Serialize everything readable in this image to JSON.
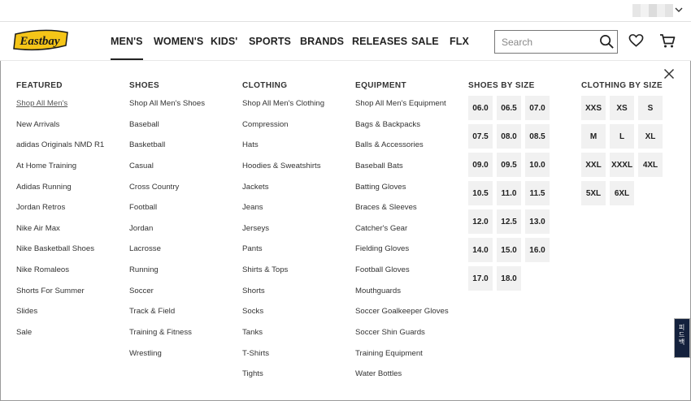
{
  "brand": {
    "logo_text": "Eastbay",
    "accent": "#f5c518"
  },
  "nav": {
    "items": [
      {
        "label": "MEN'S",
        "active": true
      },
      {
        "label": "WOMEN'S"
      },
      {
        "label": "KIDS'"
      },
      {
        "label": "SPORTS"
      },
      {
        "label": "BRANDS"
      },
      {
        "label": "RELEASES"
      },
      {
        "label": "SALE"
      },
      {
        "label": "FLX"
      }
    ]
  },
  "search": {
    "placeholder": "Search"
  },
  "icons": {
    "search": "search-icon",
    "wishlist": "heart-icon",
    "cart": "cart-icon",
    "close": "close-icon",
    "account": "chevron-down-icon"
  },
  "menu": {
    "featured": {
      "title": "FEATURED",
      "items": [
        "Shop All Men's",
        "New Arrivals",
        "adidas Originals NMD R1",
        "At Home Training",
        "Adidas Running",
        "Jordan Retros",
        "Nike Air Max",
        "Nike Basketball Shoes",
        "Nike Romaleos",
        "Shorts For Summer",
        "Slides",
        "Sale"
      ]
    },
    "shoes": {
      "title": "SHOES",
      "items": [
        "Shop All Men's Shoes",
        "Baseball",
        "Basketball",
        "Casual",
        "Cross Country",
        "Football",
        "Jordan",
        "Lacrosse",
        "Running",
        "Soccer",
        "Track & Field",
        "Training & Fitness",
        "Wrestling"
      ]
    },
    "clothing": {
      "title": "CLOTHING",
      "items": [
        "Shop All Men's Clothing",
        "Compression",
        "Hats",
        "Hoodies & Sweatshirts",
        "Jackets",
        "Jeans",
        "Jerseys",
        "Pants",
        "Shirts & Tops",
        "Shorts",
        "Socks",
        "Tanks",
        "T-Shirts",
        "Tights"
      ]
    },
    "equipment": {
      "title": "EQUIPMENT",
      "items": [
        "Shop All Men's Equipment",
        "Bags & Backpacks",
        "Balls & Accessories",
        "Baseball Bats",
        "Batting Gloves",
        "Braces & Sleeves",
        "Catcher's Gear",
        "Fielding Gloves",
        "Football Gloves",
        "Mouthguards",
        "Soccer Goalkeeper Gloves",
        "Soccer Shin Guards",
        "Training Equipment",
        "Water Bottles"
      ]
    },
    "shoe_sizes": {
      "title": "SHOES BY SIZE",
      "sizes": [
        "06.0",
        "06.5",
        "07.0",
        "07.5",
        "08.0",
        "08.5",
        "09.0",
        "09.5",
        "10.0",
        "10.5",
        "11.0",
        "11.5",
        "12.0",
        "12.5",
        "13.0",
        "14.0",
        "15.0",
        "16.0",
        "17.0",
        "18.0"
      ]
    },
    "clothing_sizes": {
      "title": "CLOTHING BY SIZE",
      "sizes": [
        "XXS",
        "XS",
        "S",
        "M",
        "L",
        "XL",
        "XXL",
        "XXXL",
        "4XL",
        "5XL",
        "6XL"
      ]
    }
  },
  "feedback": {
    "label": "피드백"
  }
}
